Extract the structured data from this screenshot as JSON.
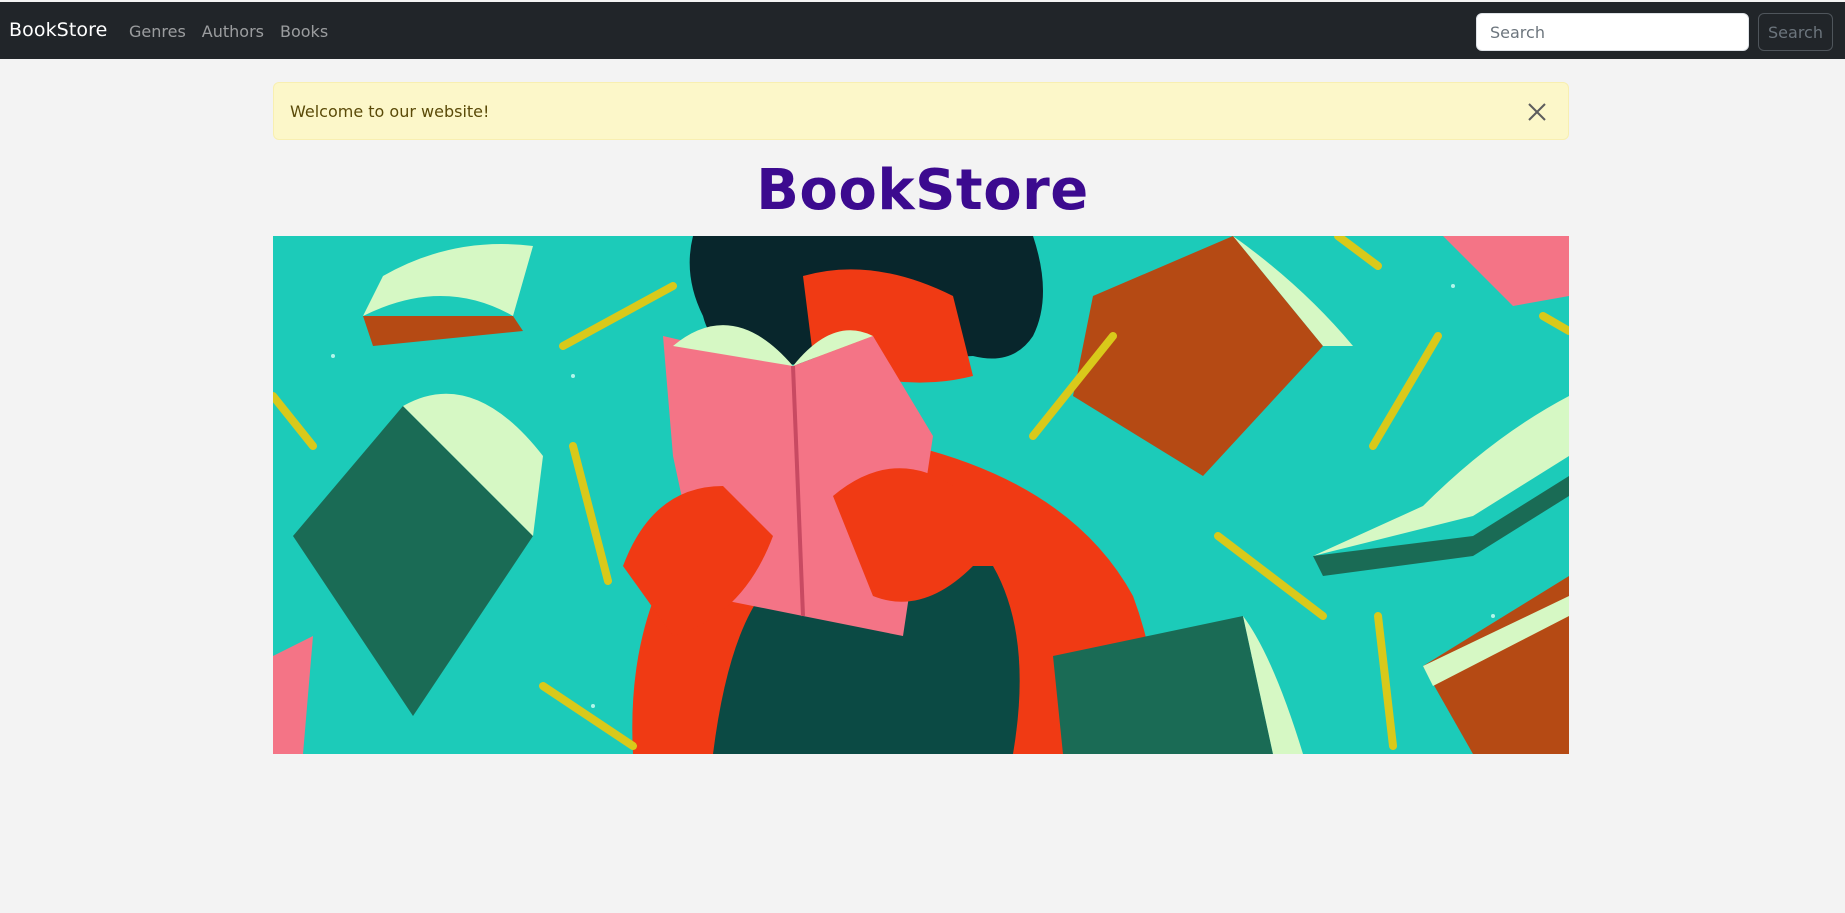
{
  "navbar": {
    "brand": "BookStore",
    "links": [
      "Genres",
      "Authors",
      "Books"
    ],
    "search_placeholder": "Search",
    "search_button": "Search"
  },
  "alert": {
    "message": "Welcome to our website!",
    "close_icon": "close-icon"
  },
  "main": {
    "title": "BookStore",
    "hero_image_icon": "hero-illustration"
  },
  "colors": {
    "navbar_bg": "#212529",
    "page_bg": "#f3f3f3",
    "alert_bg": "#fcf7c9",
    "title": "#3c0a8f",
    "hero_bg": "#1ccbb9"
  }
}
